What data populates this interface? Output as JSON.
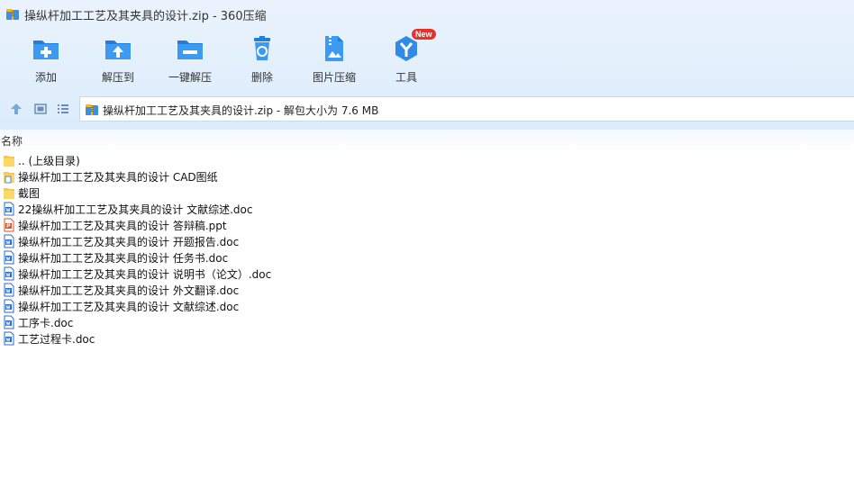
{
  "window": {
    "title": "操纵杆加工工艺及其夹具的设计.zip - 360压缩"
  },
  "toolbar": {
    "items": [
      {
        "label": "添加",
        "icon": "add-icon"
      },
      {
        "label": "解压到",
        "icon": "extract-to-icon"
      },
      {
        "label": "一键解压",
        "icon": "one-click-extract-icon"
      },
      {
        "label": "删除",
        "icon": "delete-icon"
      },
      {
        "label": "图片压缩",
        "icon": "image-compress-icon"
      },
      {
        "label": "工具",
        "icon": "tools-icon",
        "badge": "New"
      }
    ]
  },
  "address": {
    "text": "操纵杆加工工艺及其夹具的设计.zip - 解包大小为 7.6 MB"
  },
  "columns": {
    "name": "名称"
  },
  "files": [
    {
      "name": ".. (上级目录)",
      "type": "folder"
    },
    {
      "name": "操纵杆加工工艺及其夹具的设计 CAD图纸",
      "type": "folder-doc"
    },
    {
      "name": "截图",
      "type": "folder"
    },
    {
      "name": "22操纵杆加工工艺及其夹具的设计 文献综述.doc",
      "type": "doc"
    },
    {
      "name": "操纵杆加工工艺及其夹具的设计 答辩稿.ppt",
      "type": "ppt"
    },
    {
      "name": "操纵杆加工工艺及其夹具的设计 开题报告.doc",
      "type": "doc"
    },
    {
      "name": "操纵杆加工工艺及其夹具的设计 任务书.doc",
      "type": "doc"
    },
    {
      "name": "操纵杆加工工艺及其夹具的设计 说明书（论文）.doc",
      "type": "doc"
    },
    {
      "name": "操纵杆加工工艺及其夹具的设计 外文翻译.doc",
      "type": "doc"
    },
    {
      "name": "操纵杆加工工艺及其夹具的设计 文献综述.doc",
      "type": "doc"
    },
    {
      "name": "工序卡.doc",
      "type": "doc"
    },
    {
      "name": "工艺过程卡.doc",
      "type": "doc"
    }
  ],
  "colors": {
    "accent": "#2f8be6",
    "folder": "#f7c948",
    "doc": "#2a6cc9",
    "ppt": "#d9542b"
  }
}
